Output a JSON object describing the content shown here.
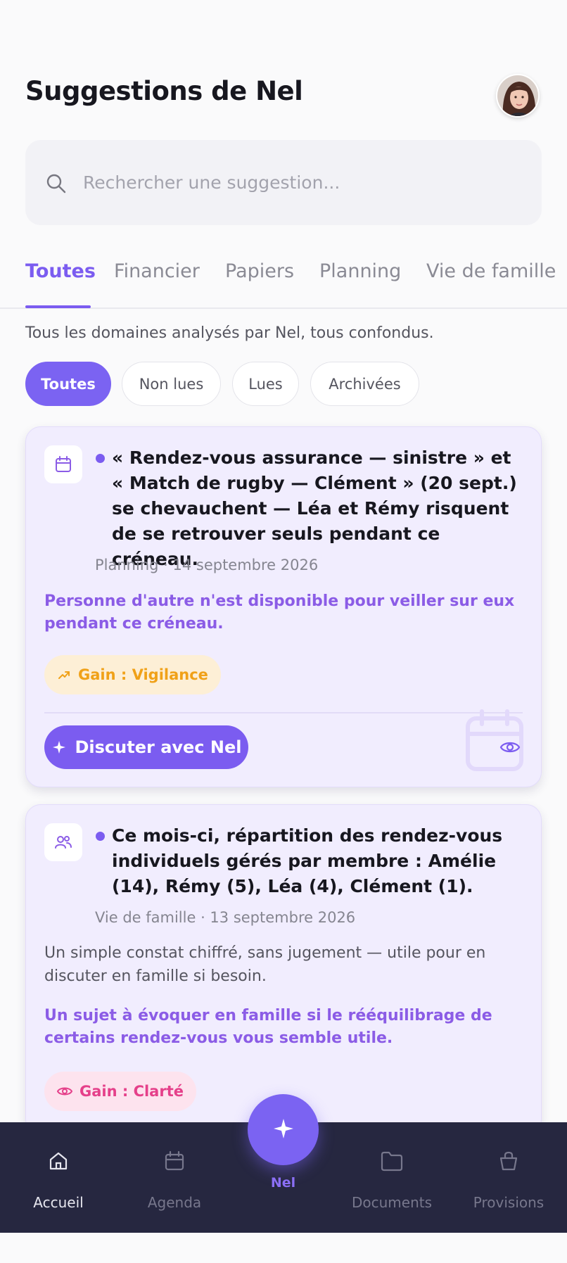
{
  "header": {
    "title": "Suggestions de Nel"
  },
  "search": {
    "placeholder": "Rechercher une suggestion..."
  },
  "tabs": [
    {
      "label": "Toutes",
      "active": true
    },
    {
      "label": "Financier",
      "active": false
    },
    {
      "label": "Papiers",
      "active": false
    },
    {
      "label": "Planning",
      "active": false
    },
    {
      "label": "Vie de famille",
      "active": false
    }
  ],
  "description": "Tous les domaines analysés par Nel, tous confondus.",
  "filters": [
    {
      "label": "Toutes",
      "active": true
    },
    {
      "label": "Non lues",
      "active": false
    },
    {
      "label": "Lues",
      "active": false
    },
    {
      "label": "Archivées",
      "active": false
    }
  ],
  "cards": [
    {
      "icon": "calendar-icon",
      "unread": true,
      "title": "« Rendez-vous assurance — sinistre » et « Match de rugby — Clément » (20 sept.) se chevauchent — Léa et Rémy risquent de se retrouver seuls pendant ce créneau.",
      "meta": "Planning · 14 septembre 2026",
      "hint": "Personne d'autre n'est disponible pour veiller sur eux pendant ce créneau.",
      "gain": "Gain : Vigilance",
      "gain_icon": "trending-up-icon",
      "action": "Discuter avec Nel"
    },
    {
      "icon": "users-icon",
      "unread": true,
      "title": "Ce mois-ci, répartition des rendez-vous individuels gérés par membre : Amélie (14), Rémy (5), Léa (4), Clément (1).",
      "meta": "Vie de famille · 13 septembre 2026",
      "body": "Un simple constat chiffré, sans jugement — utile pour en discuter en famille si besoin.",
      "hint": "Un sujet à évoquer en famille si le rééquilibrage de certains rendez-vous vous semble utile.",
      "gain": "Gain : Clarté",
      "gain_icon": "eye-icon"
    }
  ],
  "nav": {
    "items": [
      {
        "label": "Accueil",
        "icon": "home-icon",
        "active": true
      },
      {
        "label": "Agenda",
        "icon": "calendar-icon",
        "active": false
      },
      {
        "label": "Nel",
        "icon": "sparkle-icon",
        "active": false
      },
      {
        "label": "Documents",
        "icon": "folder-icon",
        "active": false
      },
      {
        "label": "Provisions",
        "icon": "basket-icon",
        "active": false
      }
    ]
  },
  "colors": {
    "accent": "#7b5cf0",
    "card_bg": "#f1edfe",
    "nav_bg": "#262740",
    "gain_orange": "#f0a118",
    "gain_pink": "#e5408a"
  }
}
